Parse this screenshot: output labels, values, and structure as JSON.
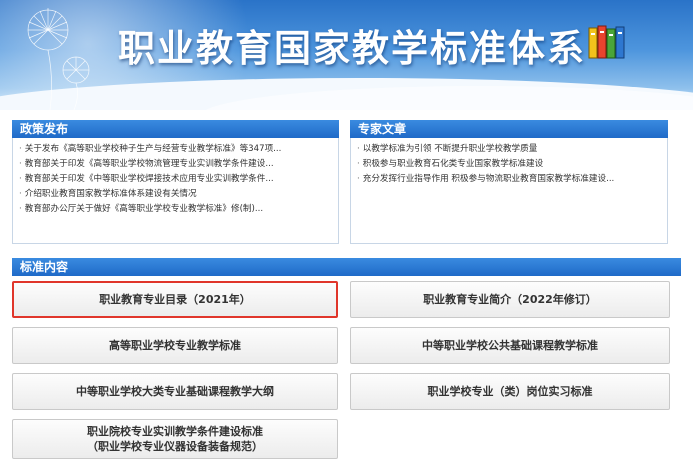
{
  "banner": {
    "title": "职业教育国家教学标准体系",
    "icons": [
      "dandelion-icon",
      "books-icon"
    ]
  },
  "policy": {
    "heading": "政策发布",
    "items": [
      "关于发布《高等职业学校种子生产与经营专业教学标准》等347项...",
      "教育部关于印发《高等职业学校物流管理专业实训教学条件建设...",
      "教育部关于印发《中等职业学校焊接技术应用专业实训教学条件...",
      "介绍职业教育国家教学标准体系建设有关情况",
      "教育部办公厅关于做好《高等职业学校专业教学标准》修(制)..."
    ]
  },
  "experts": {
    "heading": "专家文章",
    "items": [
      "以教学标准为引领 不断提升职业学校教学质量",
      "积极参与职业教育石化类专业国家教学标准建设",
      "充分发挥行业指导作用 积极参与物流职业教育国家教学标准建设..."
    ]
  },
  "standards": {
    "heading": "标准内容",
    "buttons": [
      {
        "label": "职业教育专业目录（2021年）",
        "selected": true
      },
      {
        "label": "职业教育专业简介（2022年修订）"
      },
      {
        "label": "高等职业学校专业教学标准"
      },
      {
        "label": "中等职业学校公共基础课程教学标准"
      },
      {
        "label": "中等职业学校大类专业基础课程教学大纲"
      },
      {
        "label": "职业学校专业（类）岗位实习标准"
      },
      {
        "label_line1": "职业院校专业实训教学条件建设标准",
        "label_line2": "（职业学校专业仪器设备装备规范）"
      }
    ]
  },
  "colors": {
    "accent": "#1f6ac8",
    "selected_border": "#e0362b",
    "button_text": "#333333"
  }
}
